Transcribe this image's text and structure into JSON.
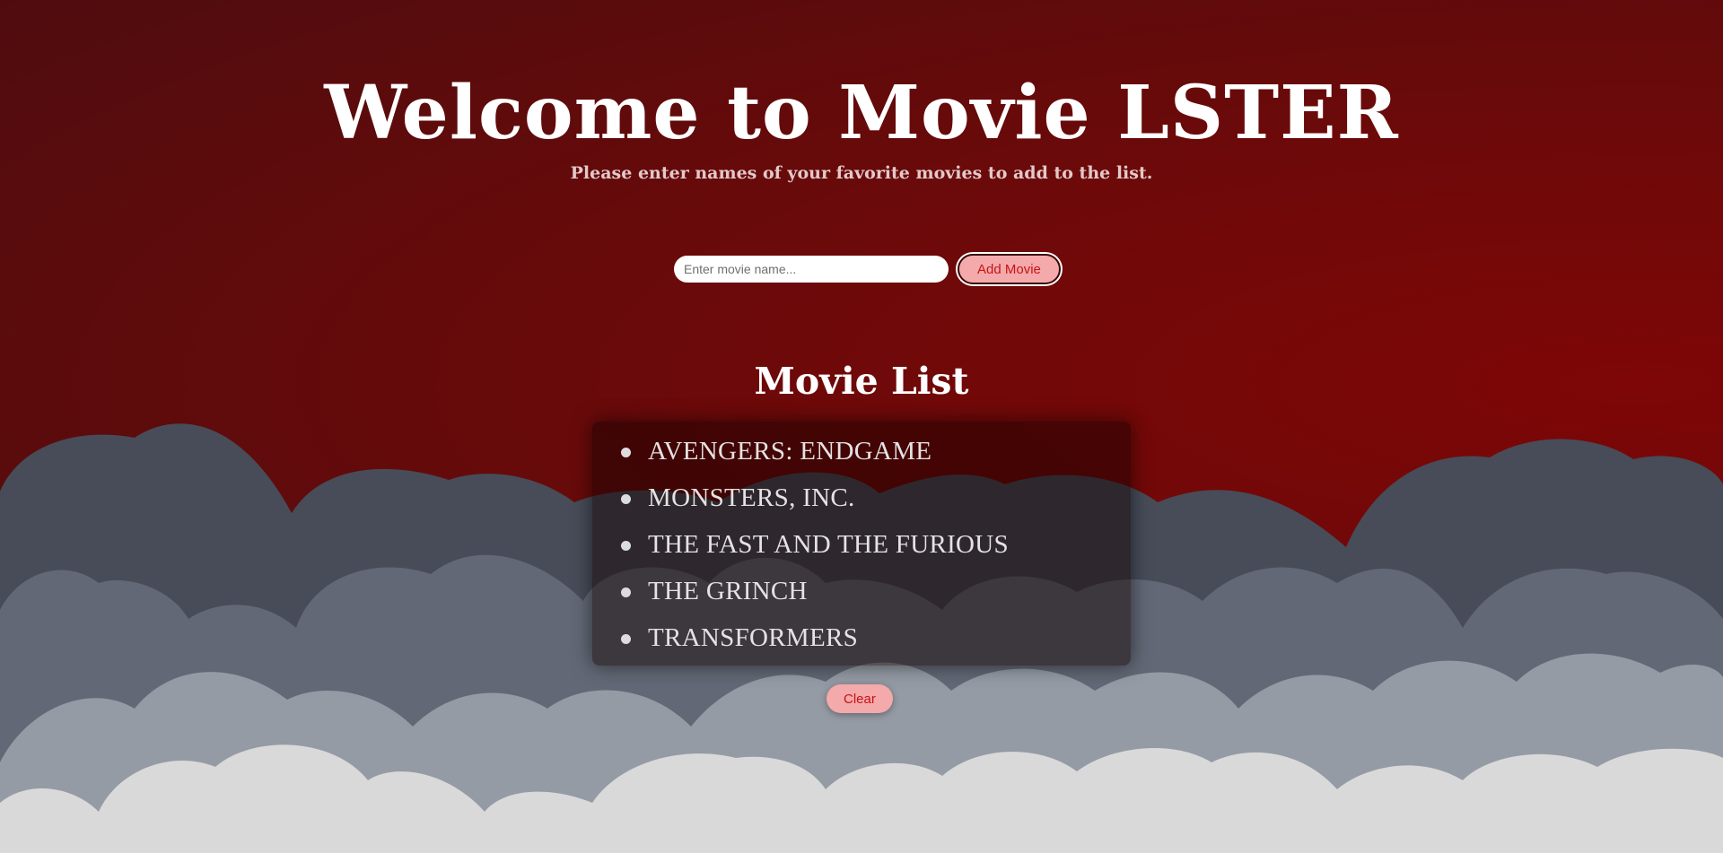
{
  "header": {
    "title": "Welcome to Movie LSTER",
    "subtitle": "Please enter names of your favorite movies to add to the list."
  },
  "form": {
    "input_placeholder": "Enter movie name...",
    "input_value": "",
    "add_button_label": "Add Movie"
  },
  "movie_list": {
    "heading": "Movie List",
    "items": [
      "AVENGERS: ENDGAME",
      "MONSTERS, INC.",
      "THE FAST AND THE FURIOUS",
      "THE GRINCH",
      "TRANSFORMERS"
    ]
  },
  "actions": {
    "clear_button_label": "Clear"
  },
  "colors": {
    "background_red": "#6f0909",
    "cloud_dark": "#474c58",
    "cloud_mid": "#626875",
    "cloud_light": "#959ba5",
    "cloud_lightest": "#d9d9d9",
    "button_fill": "#f4a9ab",
    "button_text": "#c61414"
  }
}
